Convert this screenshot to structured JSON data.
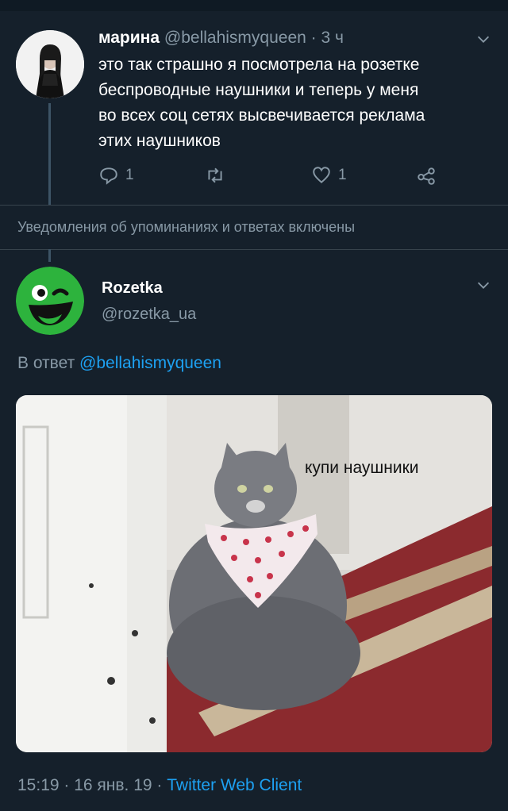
{
  "tweet": {
    "author_name": "марина",
    "author_handle": "@bellahismyqueen",
    "time": " · 3 ч",
    "text_lines": [
      "это так страшно я посмотрела на розетке",
      "беспроводные наушники и теперь у меня",
      "во всех соц сетях высвечивается реклама",
      "этих наушников"
    ],
    "reply_count": "1",
    "like_count": "1"
  },
  "notice": "Уведомления об упоминаниях и ответах включены",
  "reply_tweet": {
    "author_name": "Rozetka",
    "author_handle": "@rozetka_ua",
    "reply_prefix": "В ответ",
    "reply_to": "@bellahismyqueen",
    "image_caption": "купи наушники",
    "timestamp": "15:19 · 16 янв. 19 · ",
    "client": "Twitter Web Client"
  },
  "colors": {
    "background": "#15202b",
    "muted": "#8899a6",
    "link": "#1da1f2",
    "brand_green": "#2db33d"
  },
  "icons": [
    "chevron-down-icon",
    "reply-icon",
    "retweet-icon",
    "like-icon",
    "share-icon",
    "rozetka-logo"
  ]
}
